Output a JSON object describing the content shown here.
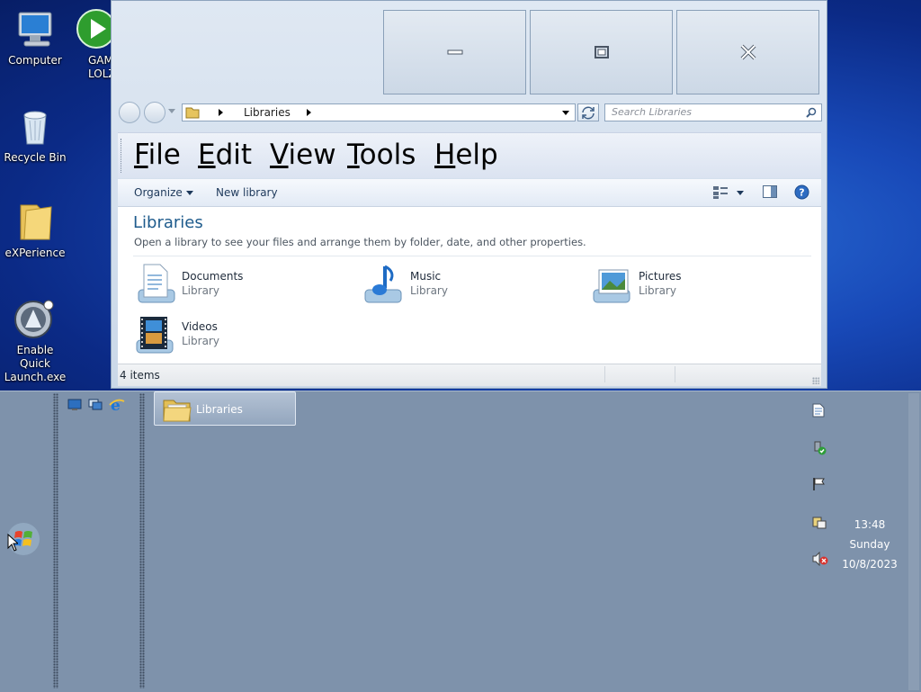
{
  "desktop": {
    "icons": [
      {
        "label": "Computer",
        "icon": "computer-icon"
      },
      {
        "label": "GAM\nLOLZZZ",
        "icon": "play-icon"
      },
      {
        "label": "Recycle Bin",
        "icon": "recycle-bin-icon"
      },
      {
        "label": "eXPerience",
        "icon": "folder-icon"
      },
      {
        "label": "Enable Quick\nLaunch.exe",
        "icon": "launch-icon"
      }
    ]
  },
  "window": {
    "caption_buttons": {
      "minimize": "minimize-icon",
      "maximize": "maximize-icon",
      "close": "close-icon"
    },
    "address": {
      "crumb": "Libraries"
    },
    "search": {
      "placeholder": "Search Libraries"
    },
    "menu": [
      {
        "label": "File",
        "accel": "F",
        "rest": "ile"
      },
      {
        "label": "Edit",
        "accel": "E",
        "rest": "dit"
      },
      {
        "label": "View",
        "accel": "V",
        "rest": "iew"
      },
      {
        "label": "Tools",
        "accel": "T",
        "rest": "ools"
      },
      {
        "label": "Help",
        "accel": "H",
        "rest": "elp"
      }
    ],
    "commands": {
      "organize": "Organize",
      "new_library": "New library"
    },
    "content": {
      "title": "Libraries",
      "subtitle": "Open a library to see your files and arrange them by folder, date, and other properties.",
      "items": [
        {
          "name": "Documents",
          "type": "Library",
          "icon": "documents-icon"
        },
        {
          "name": "Music",
          "type": "Library",
          "icon": "music-icon"
        },
        {
          "name": "Pictures",
          "type": "Library",
          "icon": "pictures-icon"
        },
        {
          "name": "Videos",
          "type": "Library",
          "icon": "videos-icon"
        }
      ]
    },
    "status": {
      "count": "4 items"
    }
  },
  "taskbar": {
    "active_task": "Libraries",
    "clock": {
      "time": "13:48",
      "day": "Sunday",
      "date": "10/8/2023"
    }
  }
}
